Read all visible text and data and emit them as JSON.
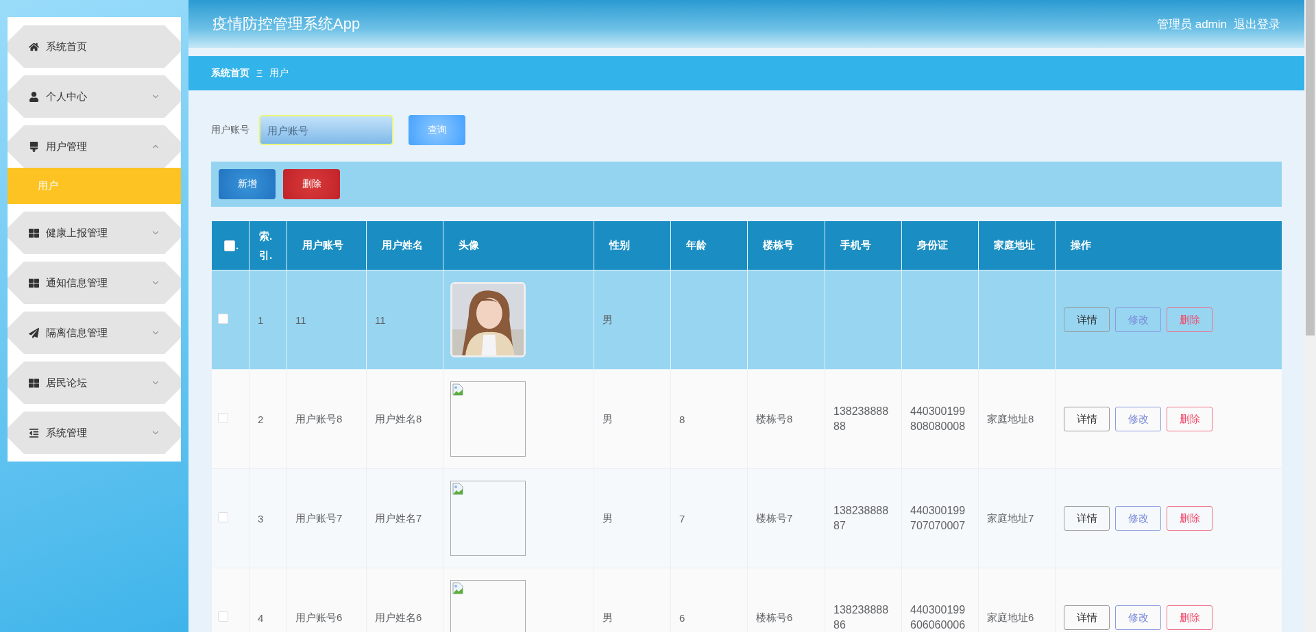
{
  "header": {
    "title": "疫情防控管理系统App",
    "user": "管理员 admin",
    "logout": "退出登录"
  },
  "sidebar": {
    "items": [
      {
        "label": "系统首页"
      },
      {
        "label": "个人中心",
        "expanded": false
      },
      {
        "label": "用户管理",
        "expanded": true,
        "children": [
          {
            "label": "用户",
            "selected": true
          }
        ]
      },
      {
        "label": "健康上报管理",
        "expanded": false
      },
      {
        "label": "通知信息管理",
        "expanded": false
      },
      {
        "label": "隔离信息管理",
        "expanded": false
      },
      {
        "label": "居民论坛",
        "expanded": false
      },
      {
        "label": "系统管理",
        "expanded": false
      }
    ]
  },
  "breadcrumb": {
    "items": [
      "系统首页",
      "用户"
    ],
    "separator": "Ξ"
  },
  "search": {
    "label": "用户账号",
    "placeholder": "用户账号",
    "button": "查询"
  },
  "actions": [
    "新增",
    "删除"
  ],
  "table": {
    "header_checkbox": {
      "checked": false,
      "mark": "."
    },
    "columns": [
      "索.引.",
      "用户账号",
      "用户姓名",
      "头像",
      "性别",
      "年龄",
      "楼栋号",
      "手机号",
      "身份证",
      "家庭地址",
      "操作"
    ],
    "rows": [
      {
        "selected": true,
        "checked": false,
        "index": "1",
        "account": "11",
        "name": "11",
        "avatar": {
          "kind": "picture"
        },
        "gender": "男",
        "buttons": [
          "详情",
          "修改",
          "删除"
        ]
      },
      {
        "selected": false,
        "checked": false,
        "index": "2",
        "account": "用户账号8",
        "name": "用户姓名8",
        "avatar": {
          "kind": "broken"
        },
        "gender": "男",
        "age": "8",
        "building": "楼栋号8",
        "phone": "13823888888",
        "id_card": "440300199808080008",
        "address": "家庭地址8",
        "buttons": [
          "详情",
          "修改",
          "删除"
        ]
      },
      {
        "selected": false,
        "checked": false,
        "index": "3",
        "account": "用户账号7",
        "name": "用户姓名7",
        "avatar": {
          "kind": "broken"
        },
        "gender": "男",
        "age": "7",
        "building": "楼栋号7",
        "phone": "13823888887",
        "id_card": "440300199707070007",
        "address": "家庭地址7",
        "buttons": [
          "详情",
          "修改",
          "删除"
        ]
      },
      {
        "selected": false,
        "checked": false,
        "index": "4",
        "account": "用户账号6",
        "name": "用户姓名6",
        "avatar": {
          "kind": "broken"
        },
        "gender": "男",
        "age": "6",
        "building": "楼栋号6",
        "phone": "13823888886",
        "id_card": "440300199606060006",
        "address": "家庭地址6",
        "buttons": [
          "详情",
          "修改",
          "删除"
        ]
      }
    ]
  }
}
